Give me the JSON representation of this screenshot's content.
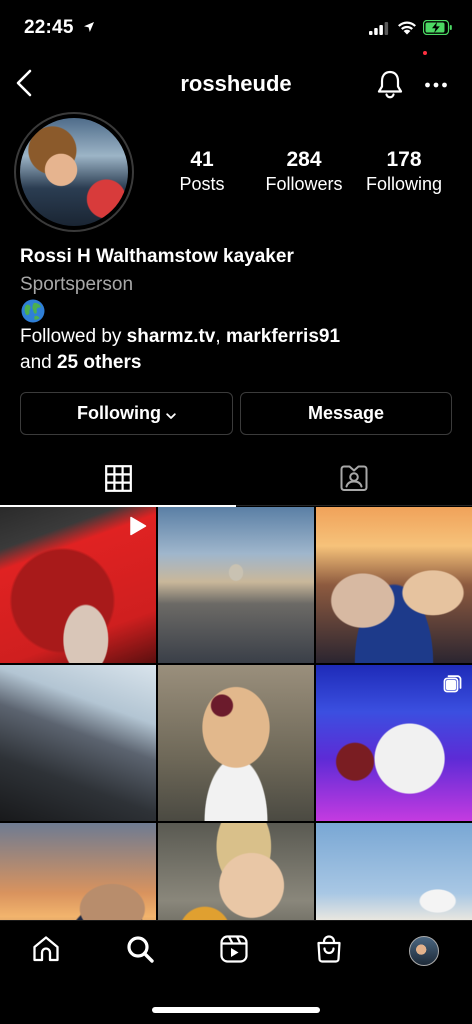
{
  "status_bar": {
    "time": "22:45"
  },
  "nav": {
    "username": "rossheude"
  },
  "profile": {
    "stats": {
      "posts": {
        "value": "41",
        "label": "Posts"
      },
      "followers": {
        "value": "284",
        "label": "Followers"
      },
      "following": {
        "value": "178",
        "label": "Following"
      }
    },
    "name": "Rossi H Walthamstow kayaker",
    "category": "Sportsperson",
    "bio_emoji": "globe-icon",
    "followed_by": {
      "prefix": "Followed by ",
      "user1": "sharmz.tv",
      "sep": ", ",
      "user2": "markferris91",
      "and": "and ",
      "others": "25 others"
    }
  },
  "actions": {
    "following_label": "Following",
    "message_label": "Message"
  },
  "tabs": [
    "grid-icon",
    "tagged-icon"
  ],
  "grid": {
    "posts": [
      {
        "kind": "reel",
        "badge": "play-icon"
      },
      {
        "kind": "photo"
      },
      {
        "kind": "photo"
      },
      {
        "kind": "photo"
      },
      {
        "kind": "photo"
      },
      {
        "kind": "carousel",
        "badge": "carousel-icon"
      },
      {
        "kind": "photo"
      },
      {
        "kind": "photo"
      },
      {
        "kind": "photo"
      }
    ]
  },
  "tab_bar": [
    "home-icon",
    "search-icon",
    "reels-icon",
    "shop-icon",
    "profile-avatar"
  ],
  "colors": {
    "background": "#000000",
    "secondary_text": "#a8a8a8",
    "border": "#3b3b3b",
    "notification_dot": "#ff3040",
    "battery_green": "#4cd964"
  }
}
